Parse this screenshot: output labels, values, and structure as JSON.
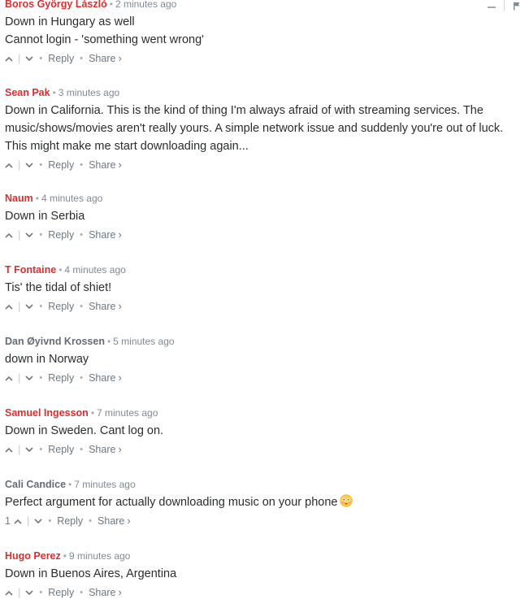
{
  "actions": {
    "reply": "Reply",
    "share": "Share",
    "share_caret": "›"
  },
  "colors": {
    "author_red": "#dd2e2e",
    "author_grey": "#626d79",
    "meta_grey": "#7f8a95",
    "body_text": "#2a2e2e"
  },
  "comments": [
    {
      "author": "Boros György László",
      "author_color": "red",
      "time": "2 minutes ago",
      "lines": [
        "Down in Hungary as well",
        "Cannot login - 'something went wrong'"
      ],
      "votes": ""
    },
    {
      "author": "Sean Pak",
      "author_color": "red",
      "time": "3 minutes ago",
      "lines": [
        "Down in California. This is the kind of thing I'm always afraid of with streaming services. The",
        "music/shows/movies aren't really yours. A simple network issue and suddenly you're out of luck.",
        "This might make me start downloading again..."
      ],
      "votes": ""
    },
    {
      "author": "Naum",
      "author_color": "red",
      "time": "4 minutes ago",
      "lines": [
        "Down in Serbia"
      ],
      "votes": ""
    },
    {
      "author": "T Fontaine",
      "author_color": "red",
      "time": "4 minutes ago",
      "lines": [
        "Tis' the tidal of shiet!"
      ],
      "votes": ""
    },
    {
      "author": "Dan Øyivnd Krossen",
      "author_color": "grey",
      "time": "5 minutes ago",
      "lines": [
        "down in Norway"
      ],
      "votes": ""
    },
    {
      "author": "Samuel Ingesson",
      "author_color": "red",
      "time": "7 minutes ago",
      "lines": [
        "Down in Sweden. Cant log on."
      ],
      "votes": ""
    },
    {
      "author": "Cali Candice",
      "author_color": "grey",
      "time": "7 minutes ago",
      "lines": [
        "Perfect argument for actually downloading music on your phone"
      ],
      "emoji": "flushed-face-emoji",
      "votes": "1"
    },
    {
      "author": "Hugo Perez",
      "author_color": "red",
      "time": "9 minutes ago",
      "lines": [
        "Down in Buenos Aires, Argentina"
      ],
      "votes": ""
    }
  ]
}
